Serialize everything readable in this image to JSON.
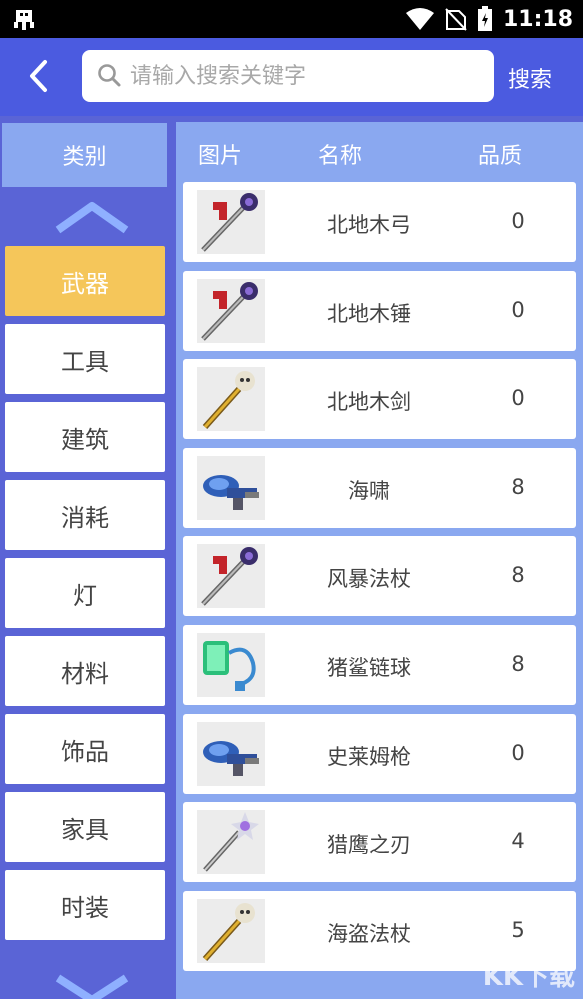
{
  "status_bar": {
    "time": "11:18",
    "app_icon": "bug-icon"
  },
  "header": {
    "back_icon": "chevron-left-icon",
    "search_placeholder": "请输入搜索关键字",
    "search_value": "",
    "search_button": "搜索"
  },
  "sidebar": {
    "title": "类别",
    "items": [
      {
        "label": "武器",
        "active": true
      },
      {
        "label": "工具",
        "active": false
      },
      {
        "label": "建筑",
        "active": false
      },
      {
        "label": "消耗",
        "active": false
      },
      {
        "label": "灯",
        "active": false
      },
      {
        "label": "材料",
        "active": false
      },
      {
        "label": "饰品",
        "active": false
      },
      {
        "label": "家具",
        "active": false
      },
      {
        "label": "时装",
        "active": false
      }
    ]
  },
  "table": {
    "columns": [
      "图片",
      "名称",
      "品质"
    ],
    "rows": [
      {
        "icon": "staff-red-icon",
        "name": "北地木弓",
        "quality": "0"
      },
      {
        "icon": "staff-red-icon",
        "name": "北地木锤",
        "quality": "0"
      },
      {
        "icon": "skull-staff-icon",
        "name": "北地木剑",
        "quality": "0"
      },
      {
        "icon": "blue-gun-icon",
        "name": "海啸",
        "quality": "8"
      },
      {
        "icon": "staff-red-icon",
        "name": "风暴法杖",
        "quality": "8"
      },
      {
        "icon": "green-flail-icon",
        "name": "猪鲨链球",
        "quality": "8"
      },
      {
        "icon": "blue-gun-icon",
        "name": "史莱姆枪",
        "quality": "0"
      },
      {
        "icon": "star-staff-icon",
        "name": "猎鹰之刃",
        "quality": "4"
      },
      {
        "icon": "skull-staff-icon",
        "name": "海盗法杖",
        "quality": "5"
      }
    ]
  },
  "watermark": "KK下载"
}
